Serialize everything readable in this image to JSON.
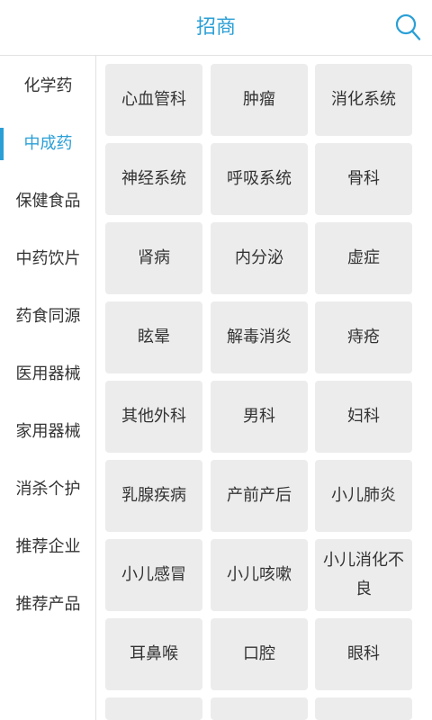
{
  "header": {
    "title": "招商"
  },
  "sidebar": {
    "items": [
      {
        "label": "化学药",
        "active": false
      },
      {
        "label": "中成药",
        "active": true
      },
      {
        "label": "保健食品",
        "active": false
      },
      {
        "label": "中药饮片",
        "active": false
      },
      {
        "label": "药食同源",
        "active": false
      },
      {
        "label": "医用器械",
        "active": false
      },
      {
        "label": "家用器械",
        "active": false
      },
      {
        "label": "消杀个护",
        "active": false
      },
      {
        "label": "推荐企业",
        "active": false
      },
      {
        "label": "推荐产品",
        "active": false
      }
    ]
  },
  "categories": [
    "心血管科",
    "肿瘤",
    "消化系统",
    "神经系统",
    "呼吸系统",
    "骨科",
    "肾病",
    "内分泌",
    "虚症",
    "眩晕",
    "解毒消炎",
    "痔疮",
    "其他外科",
    "男科",
    "妇科",
    "乳腺疾病",
    "产前产后",
    "小儿肺炎",
    "小儿感冒",
    "小儿咳嗽",
    "小儿消化不良",
    "耳鼻喉",
    "口腔",
    "眼科",
    "",
    "",
    ""
  ],
  "colors": {
    "accent": "#2a9fd6",
    "cell_bg": "#ececec"
  },
  "icons": {
    "search": "search-icon"
  }
}
